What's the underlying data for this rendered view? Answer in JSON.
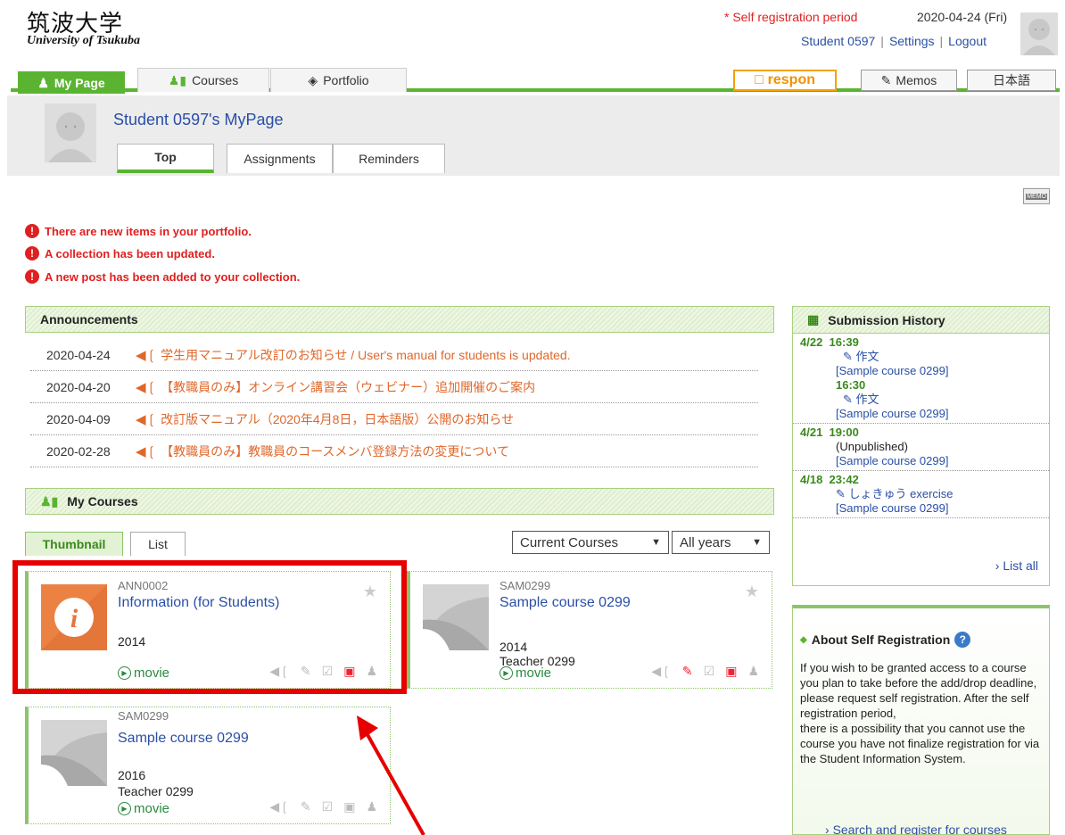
{
  "header": {
    "logo_jp": "筑波大学",
    "logo_en": "University of Tsukuba",
    "self_reg_notice": "* Self registration period",
    "date": "2020-04-24 (Fri)",
    "user": "Student 0597",
    "settings": "Settings",
    "logout": "Logout",
    "sep": "|"
  },
  "nav": {
    "mypage": "My Page",
    "courses": "Courses",
    "portfolio": "Portfolio",
    "respon": "respon",
    "memos": "Memos",
    "language": "日本語"
  },
  "mypage": {
    "title": "Student 0597's MyPage",
    "tabs": [
      "Top",
      "Assignments",
      "Reminders"
    ],
    "memo_badge": "MEMO"
  },
  "alerts": [
    "There are new items in your portfolio.",
    "A collection has been updated.",
    "A new post has been added to your collection."
  ],
  "announcements": {
    "title": "Announcements",
    "items": [
      {
        "date": "2020-04-24",
        "text": "学生用マニュアル改訂のお知らせ / User's manual for students is updated."
      },
      {
        "date": "2020-04-20",
        "text": "【教職員のみ】オンライン講習会（ウェビナー）追加開催のご案内"
      },
      {
        "date": "2020-04-09",
        "text": "改訂版マニュアル（2020年4月8日，日本語版）公開のお知らせ"
      },
      {
        "date": "2020-02-28",
        "text": "【教職員のみ】教職員のコースメンバ登録方法の変更について"
      }
    ]
  },
  "my_courses": {
    "title": "My Courses",
    "view_tabs": [
      "Thumbnail",
      "List"
    ],
    "filter_term": "Current Courses",
    "filter_year": "All years",
    "cards": [
      {
        "code": "ANN0002",
        "title": "Information (for Students)",
        "year": "2014",
        "teacher": "",
        "movie": "movie"
      },
      {
        "code": "SAM0299",
        "title": "Sample course 0299",
        "year": "2014",
        "teacher": "Teacher 0299",
        "movie": "movie"
      },
      {
        "code": "SAM0299",
        "title": "Sample course 0299",
        "year": "2016",
        "teacher": "Teacher 0299",
        "movie": "movie"
      }
    ]
  },
  "submission_history": {
    "title": "Submission History",
    "items": [
      {
        "date": "4/22",
        "time": "16:39",
        "assignment": "作文",
        "course": "[Sample course 0299]"
      },
      {
        "date": "",
        "time": "16:30",
        "assignment": "作文",
        "course": "[Sample course 0299]"
      },
      {
        "date": "4/21",
        "time": "19:00",
        "assignment": "(Unpublished)",
        "course": "[Sample course 0299]"
      },
      {
        "date": "4/18",
        "time": "23:42",
        "assignment": "しょきゅう exercise",
        "course": "[Sample course 0299]"
      }
    ],
    "list_all": "List all"
  },
  "about_self_reg": {
    "title": "About Self Registration",
    "help": "?",
    "text": "If you wish to be granted access to a course you plan to take before the add/drop deadline, please request self registration. After the self registration period,",
    "text2": "there is a possibility that you cannot use the course you have not finalize registration for via the Student Information System.",
    "link": "Search and register for courses"
  },
  "colors": {
    "accent": "#5ab431",
    "link": "#2a4fa6",
    "alert": "#e02020",
    "annotation": "#e60000"
  }
}
